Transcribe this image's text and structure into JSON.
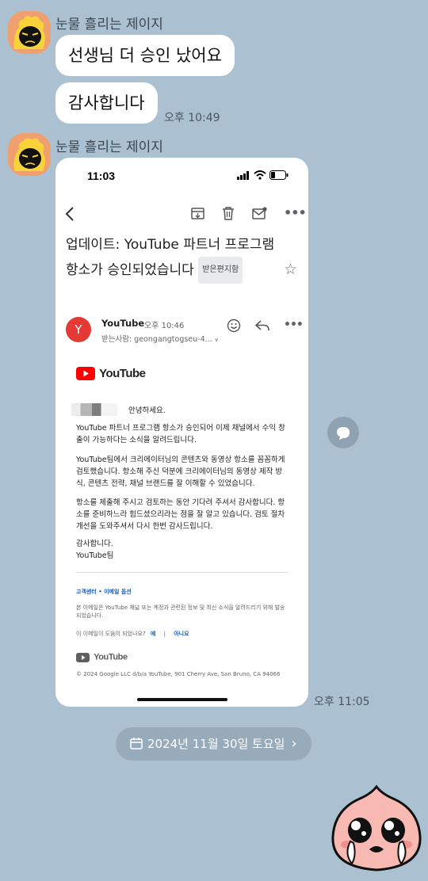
{
  "chat": {
    "sender_name": "눈물 흘리는 제이지",
    "messages": [
      {
        "text": "선생님 더 승인 났어요"
      },
      {
        "text": "감사합니다",
        "time": "오후 10:49"
      }
    ],
    "image_message_time": "오후 11:05",
    "date_divider": "2024년 11월 30일 토요일",
    "date_chevron": "›"
  },
  "shot": {
    "status_time": "11:03",
    "mail": {
      "subject_line1": "업데이트: YouTube 파트너 프로그램",
      "subject_line2": "항소가 승인되었습니다",
      "inbox_tag": "받은편지함",
      "avatar_letter": "Y",
      "sender": "YouTube",
      "sent_time": "오후 10:46",
      "recipient": "받는사람: geongangtogseu-4...",
      "logo_text": "YouTube",
      "greeting_suffix": "안녕하세요.",
      "para1": "YouTube 파트너 프로그램 항소가 승인되어 이제 채널에서 수익 창출이 가능하다는 소식을 알려드립니다.",
      "para2": "YouTube팀에서 크리에이터님의 콘텐츠와 동영상 항소를 꼼꼼하게 검토했습니다. 항소해 주신 덕분에 크리에이터님의 동영상 제작 방식, 콘텐츠 전략, 채널 브랜드를 잘 이해할 수 있었습니다.",
      "para3": "항소를 제출해 주시고 검토하는 동안 기다려 주셔서 감사합니다. 항소를 준비하느라 힘드셨으리라는 점을 잘 알고 있습니다. 검토 절차 개선을 도와주셔서 다시 한번 감사드립니다.",
      "signoff1": "감사합니다.",
      "signoff2": "YouTube팀",
      "footer_links": "고객센터 • 이메일 옵션",
      "footer_notice": "본 이메일은 YouTube 채널 또는 계정과 관련된 정보 및 최신 소식을 알려드리기 위해 발송되었습니다.",
      "helpful_question": "이 이메일이 도움이 되었나요?",
      "helpful_yes": "예",
      "helpful_sep": "|",
      "helpful_no": "아니요",
      "footer_logo_text": "YouTube",
      "copyright": "© 2024 Google LLC d/b/a YouTube, 901 Cherry Ave, San Bruno, CA 94066"
    }
  },
  "icons": {
    "back": "back-arrow-icon",
    "archive": "archive-icon",
    "trash": "trash-icon",
    "mail": "mark-unread-icon",
    "more": "more-icon",
    "star": "star-icon",
    "emoji": "emoji-icon",
    "reply": "reply-icon",
    "share": "share-icon",
    "calendar": "calendar-icon"
  },
  "colors": {
    "background": "#abc1d1",
    "youtube_red": "#ff0000",
    "sender_avatar": "#e53935",
    "link_blue": "#1a5fb4"
  }
}
